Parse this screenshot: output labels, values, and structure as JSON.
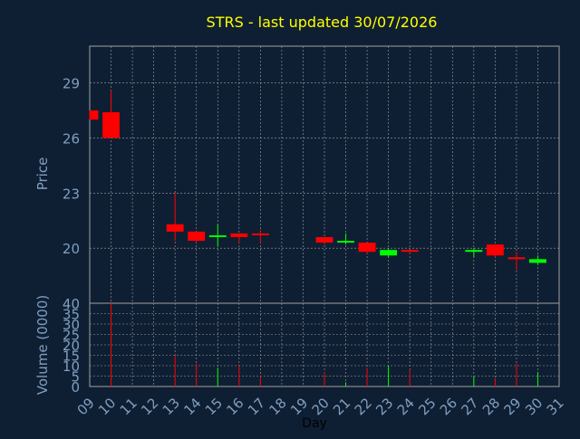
{
  "chart_data": {
    "type": "candlestick",
    "title": "STRS - last updated 30/07/2026",
    "xlabel": "Day",
    "price_panel": {
      "ylabel": "Price",
      "ylim": [
        17,
        31
      ],
      "yticks": [
        20,
        23,
        26,
        29
      ],
      "grid": true
    },
    "volume_panel": {
      "ylabel": "Volume (0000)",
      "ylim": [
        0,
        40
      ],
      "yticks": [
        0,
        5,
        10,
        15,
        20,
        25,
        30,
        35,
        40
      ],
      "grid": true
    },
    "x_ticks": [
      "09",
      "10",
      "11",
      "12",
      "13",
      "14",
      "15",
      "16",
      "17",
      "18",
      "19",
      "20",
      "21",
      "22",
      "23",
      "24",
      "25",
      "26",
      "27",
      "28",
      "29",
      "30",
      "31"
    ],
    "xlim": [
      9,
      31
    ],
    "candles": [
      {
        "day": 9,
        "open": 27.5,
        "high": 27.5,
        "low": 27.0,
        "close": 27.0,
        "volume": 0
      },
      {
        "day": 10,
        "open": 27.4,
        "high": 28.6,
        "low": 26.0,
        "close": 26.0,
        "volume": 40
      },
      {
        "day": 13,
        "open": 21.3,
        "high": 23.0,
        "low": 20.4,
        "close": 20.9,
        "volume": 15
      },
      {
        "day": 14,
        "open": 20.9,
        "high": 20.9,
        "low": 20.3,
        "close": 20.4,
        "volume": 11
      },
      {
        "day": 15,
        "open": 20.6,
        "high": 21.3,
        "low": 20.1,
        "close": 20.7,
        "volume": 9
      },
      {
        "day": 16,
        "open": 20.8,
        "high": 20.8,
        "low": 20.3,
        "close": 20.6,
        "volume": 10
      },
      {
        "day": 17,
        "open": 20.8,
        "high": 21.0,
        "low": 20.3,
        "close": 20.7,
        "volume": 5
      },
      {
        "day": 20,
        "open": 20.6,
        "high": 20.6,
        "low": 20.2,
        "close": 20.3,
        "volume": 7
      },
      {
        "day": 21,
        "open": 20.3,
        "high": 20.8,
        "low": 20.2,
        "close": 20.4,
        "volume": 2
      },
      {
        "day": 22,
        "open": 20.3,
        "high": 20.3,
        "low": 19.7,
        "close": 19.8,
        "volume": 9
      },
      {
        "day": 23,
        "open": 19.6,
        "high": 20.0,
        "low": 19.5,
        "close": 19.9,
        "volume": 10
      },
      {
        "day": 24,
        "open": 19.9,
        "high": 19.9,
        "low": 19.7,
        "close": 19.8,
        "volume": 8
      },
      {
        "day": 27,
        "open": 19.8,
        "high": 20.0,
        "low": 19.5,
        "close": 19.9,
        "volume": 5
      },
      {
        "day": 28,
        "open": 20.2,
        "high": 20.2,
        "low": 19.5,
        "close": 19.6,
        "volume": 4
      },
      {
        "day": 29,
        "open": 19.5,
        "high": 19.8,
        "low": 18.8,
        "close": 19.4,
        "volume": 11
      },
      {
        "day": 30,
        "open": 19.2,
        "high": 19.6,
        "low": 19.1,
        "close": 19.4,
        "volume": 7
      }
    ]
  },
  "colors": {
    "background": "#0f1f33",
    "title": "#ffff00",
    "axis_text": "#7f9fc0",
    "frame": "#a0a0a0",
    "grid": "#a0a0a0",
    "up": "#00ff00",
    "down": "#ff0000"
  }
}
